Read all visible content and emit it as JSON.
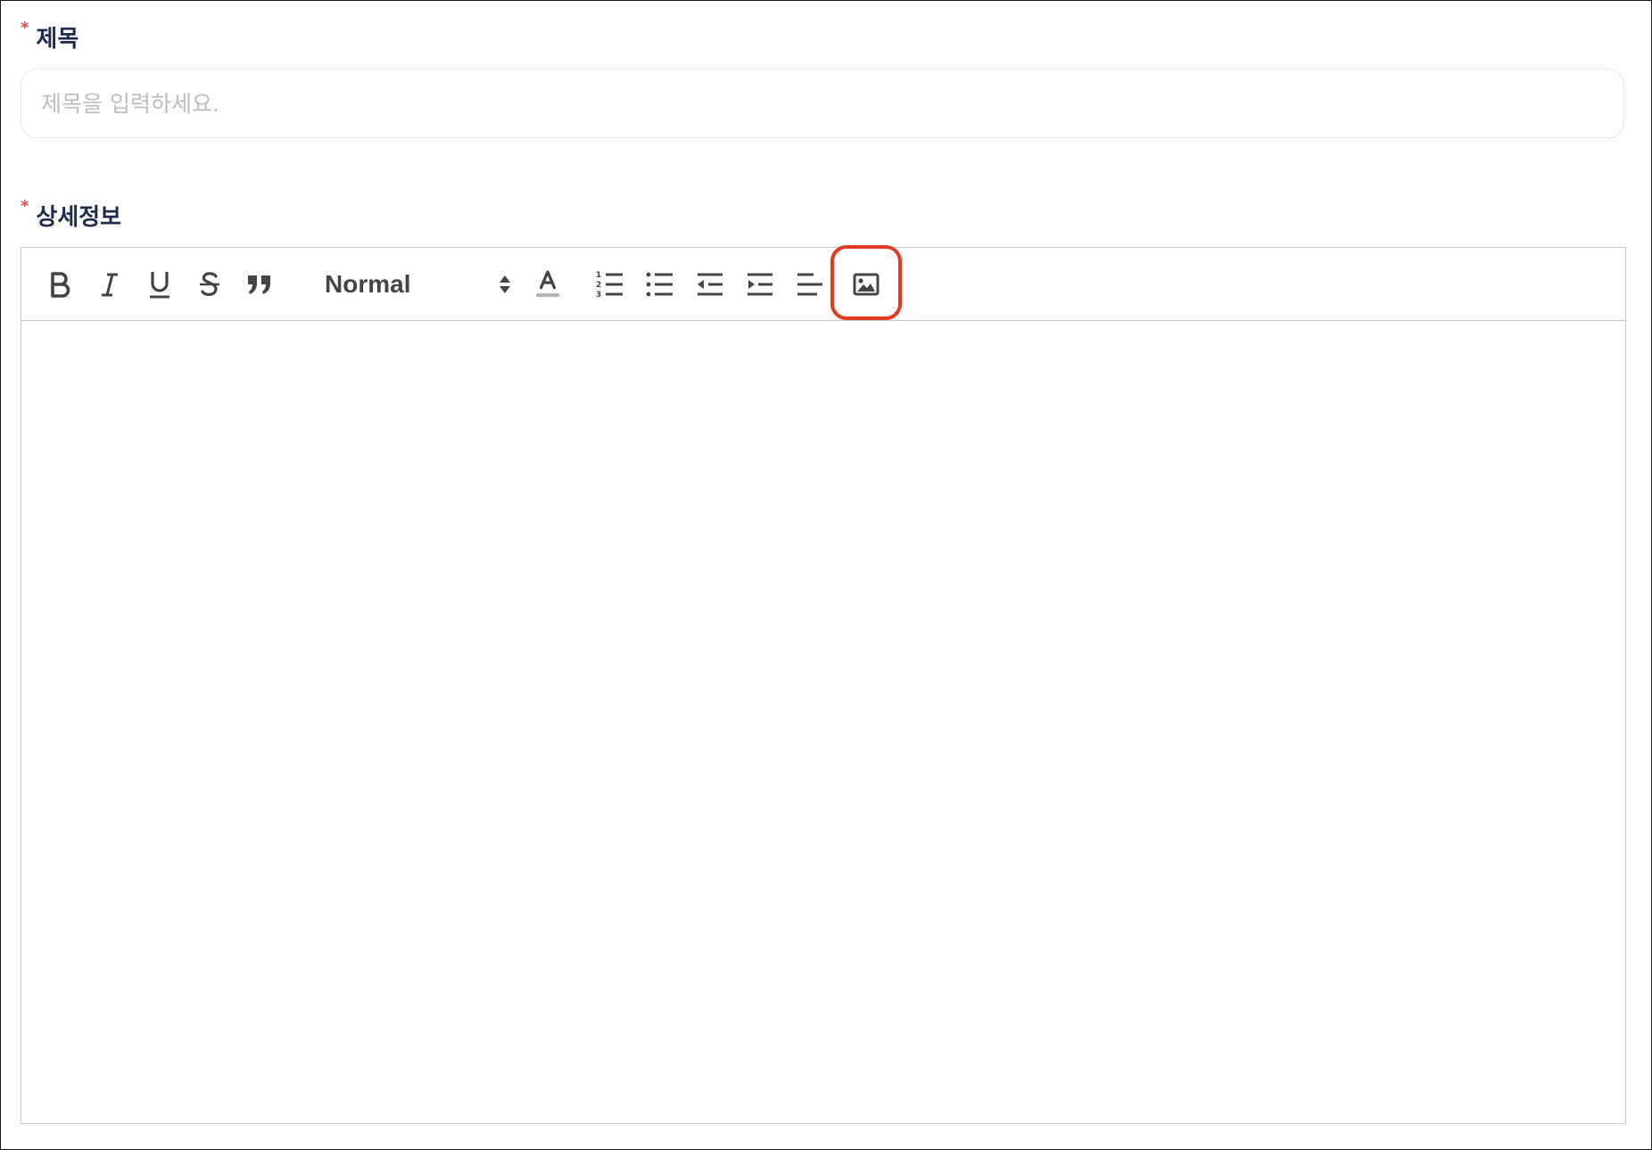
{
  "form": {
    "title_field": {
      "required_mark": "*",
      "label": "제목",
      "placeholder": "제목을 입력하세요.",
      "value": ""
    },
    "detail_field": {
      "required_mark": "*",
      "label": "상세정보"
    }
  },
  "editor": {
    "toolbar": {
      "header_select": {
        "selected": "Normal"
      },
      "buttons": [
        {
          "icon": "bold-icon"
        },
        {
          "icon": "italic-icon"
        },
        {
          "icon": "underline-icon"
        },
        {
          "icon": "strikethrough-icon"
        },
        {
          "icon": "blockquote-icon"
        },
        {
          "icon": "text-color-icon"
        },
        {
          "icon": "ordered-list-icon"
        },
        {
          "icon": "bullet-list-icon"
        },
        {
          "icon": "outdent-icon"
        },
        {
          "icon": "indent-icon"
        },
        {
          "icon": "align-left-icon"
        },
        {
          "icon": "image-icon",
          "highlighted": true
        }
      ]
    },
    "content": ""
  },
  "colors": {
    "label": "#1f2d4d",
    "required": "#e5484d",
    "highlight": "#e23a1f",
    "icon": "#444444"
  }
}
